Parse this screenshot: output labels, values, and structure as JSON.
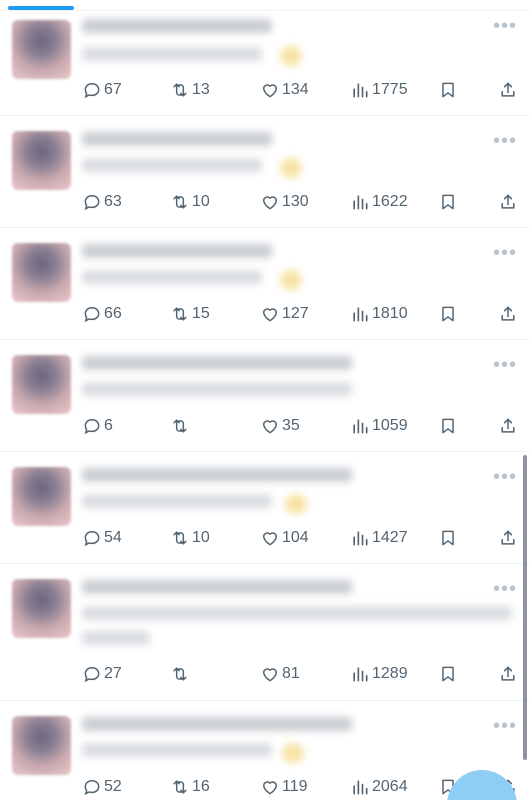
{
  "tweets": [
    {
      "replies": "67",
      "retweets": "13",
      "likes": "134",
      "views": "1775"
    },
    {
      "replies": "63",
      "retweets": "10",
      "likes": "130",
      "views": "1622"
    },
    {
      "replies": "66",
      "retweets": "15",
      "likes": "127",
      "views": "1810"
    },
    {
      "replies": "6",
      "retweets": "",
      "likes": "35",
      "views": "1059"
    },
    {
      "replies": "54",
      "retweets": "10",
      "likes": "104",
      "views": "1427"
    },
    {
      "replies": "27",
      "retweets": "",
      "likes": "81",
      "views": "1289"
    },
    {
      "replies": "52",
      "retweets": "16",
      "likes": "119",
      "views": "2064"
    }
  ],
  "icons": {
    "more": "more-dots-icon",
    "reply": "reply-icon",
    "retweet": "retweet-icon",
    "like": "heart-icon",
    "views": "views-chart-icon",
    "bookmark": "bookmark-icon",
    "share": "share-icon"
  },
  "colors": {
    "accent": "#1d9bf0",
    "icon": "#536471",
    "divider": "#eff3f4"
  }
}
